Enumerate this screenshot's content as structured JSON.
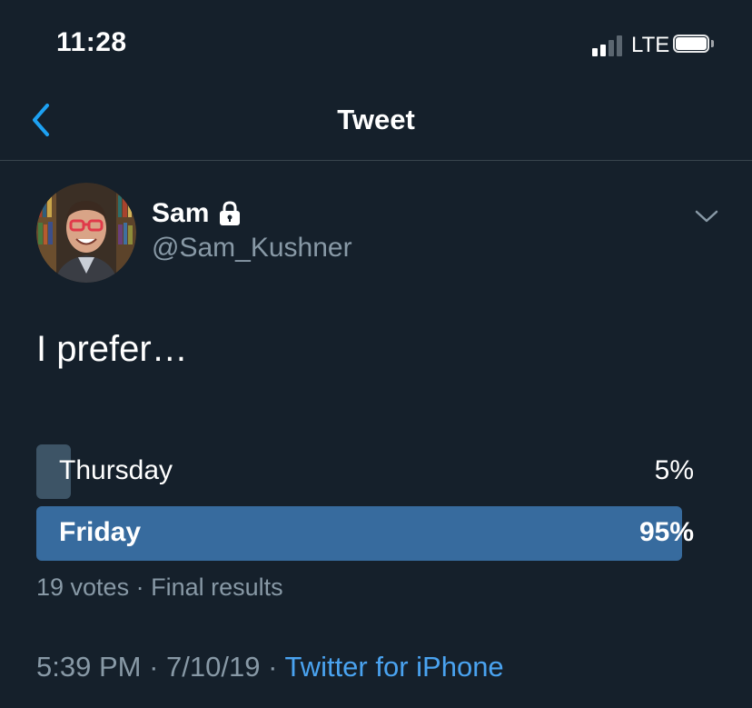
{
  "status_bar": {
    "time": "11:28",
    "network": "LTE",
    "signal_bars_active": 2,
    "signal_bars_total": 4,
    "battery_level": 0.9
  },
  "nav": {
    "title": "Tweet",
    "back_icon": "chevron-left-icon"
  },
  "tweet": {
    "author_name": "Sam",
    "author_handle": "@Sam_Kushner",
    "protected_icon": "lock-icon",
    "text": "I prefer…",
    "poll": {
      "options": [
        {
          "label": "Thursday",
          "percent_text": "5%",
          "percent": 5,
          "winner": false
        },
        {
          "label": "Friday",
          "percent_text": "95%",
          "percent": 95,
          "winner": true
        }
      ],
      "votes": "19 votes",
      "separator": " · ",
      "status": "Final results"
    },
    "time": "5:39 PM",
    "date": "7/10/19",
    "meta_separator": " · ",
    "source": "Twitter for iPhone"
  },
  "colors": {
    "background": "#15202b",
    "secondary_text": "#8899a6",
    "accent": "#1da1f2",
    "link": "#4aa3f0",
    "poll_winner": "#376b9e",
    "poll_other": "#3d5466"
  }
}
